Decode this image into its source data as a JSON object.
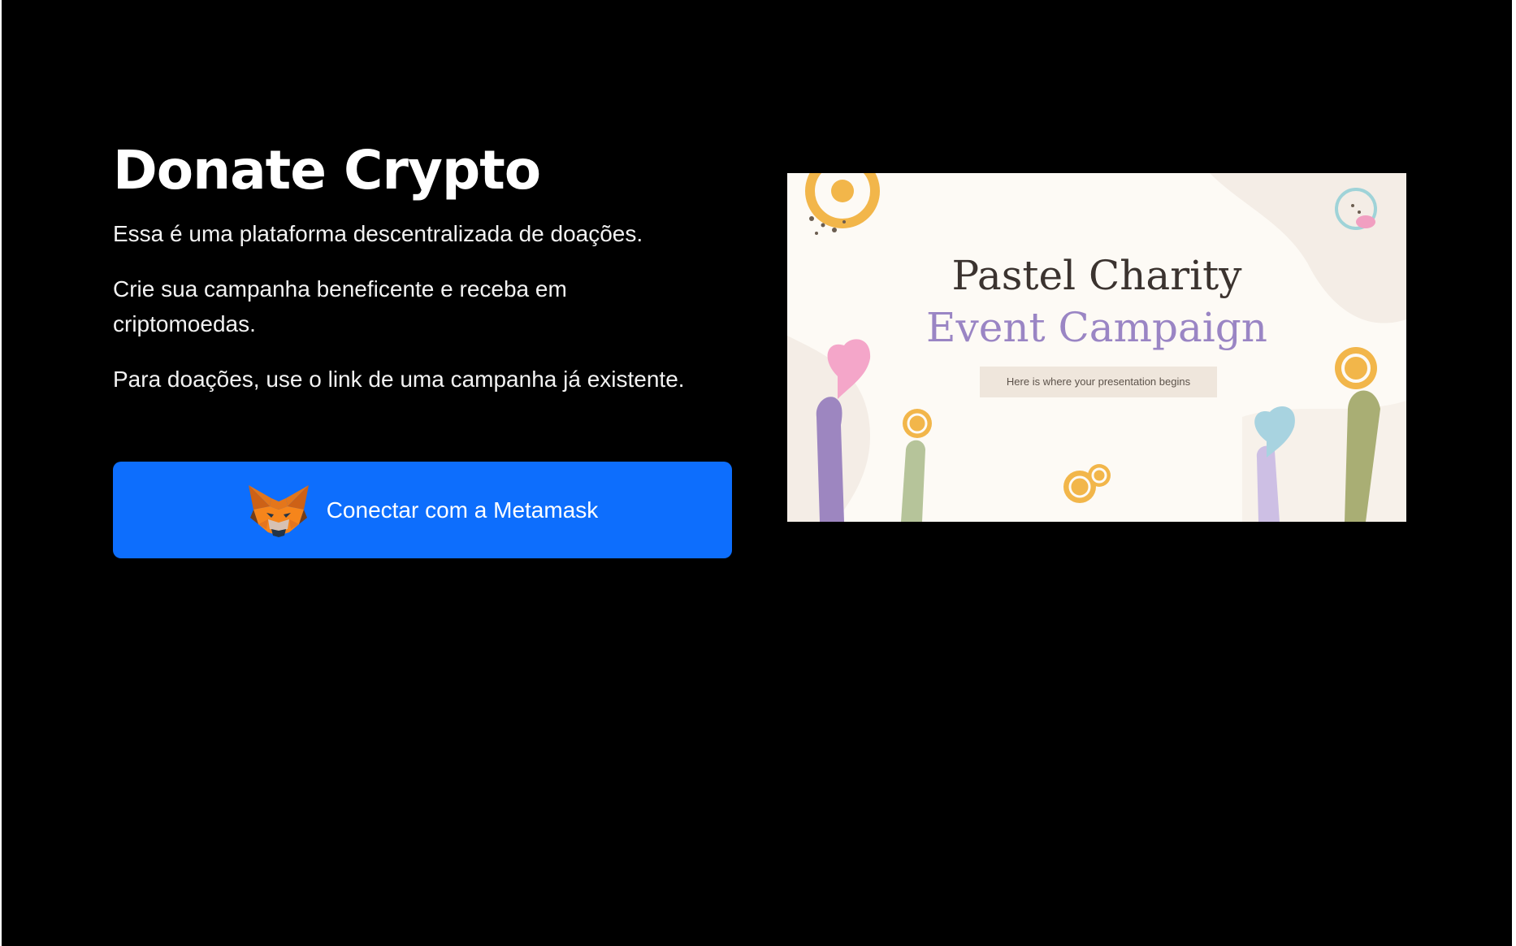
{
  "hero": {
    "title": "Donate Crypto",
    "paragraph_1": "Essa é uma plataforma descentralizada de doações.",
    "paragraph_2": "Crie sua campanha beneficente e receba em criptomoedas.",
    "paragraph_3": "Para doações, use o link de uma campanha já existente."
  },
  "connect_button": {
    "label": "Conectar com a Metamask",
    "icon": "metamask-fox-icon",
    "color": "#0d6efd"
  },
  "banner": {
    "title_line_1": "Pastel Charity",
    "title_line_2": "Event Campaign",
    "subtitle": "Here is where your presentation begins"
  },
  "colors": {
    "background": "#000000",
    "button": "#0d6efd",
    "banner_bg": "#fdfaf5",
    "banner_title_dark": "#3b332f",
    "banner_title_purple": "#9a85c4"
  }
}
